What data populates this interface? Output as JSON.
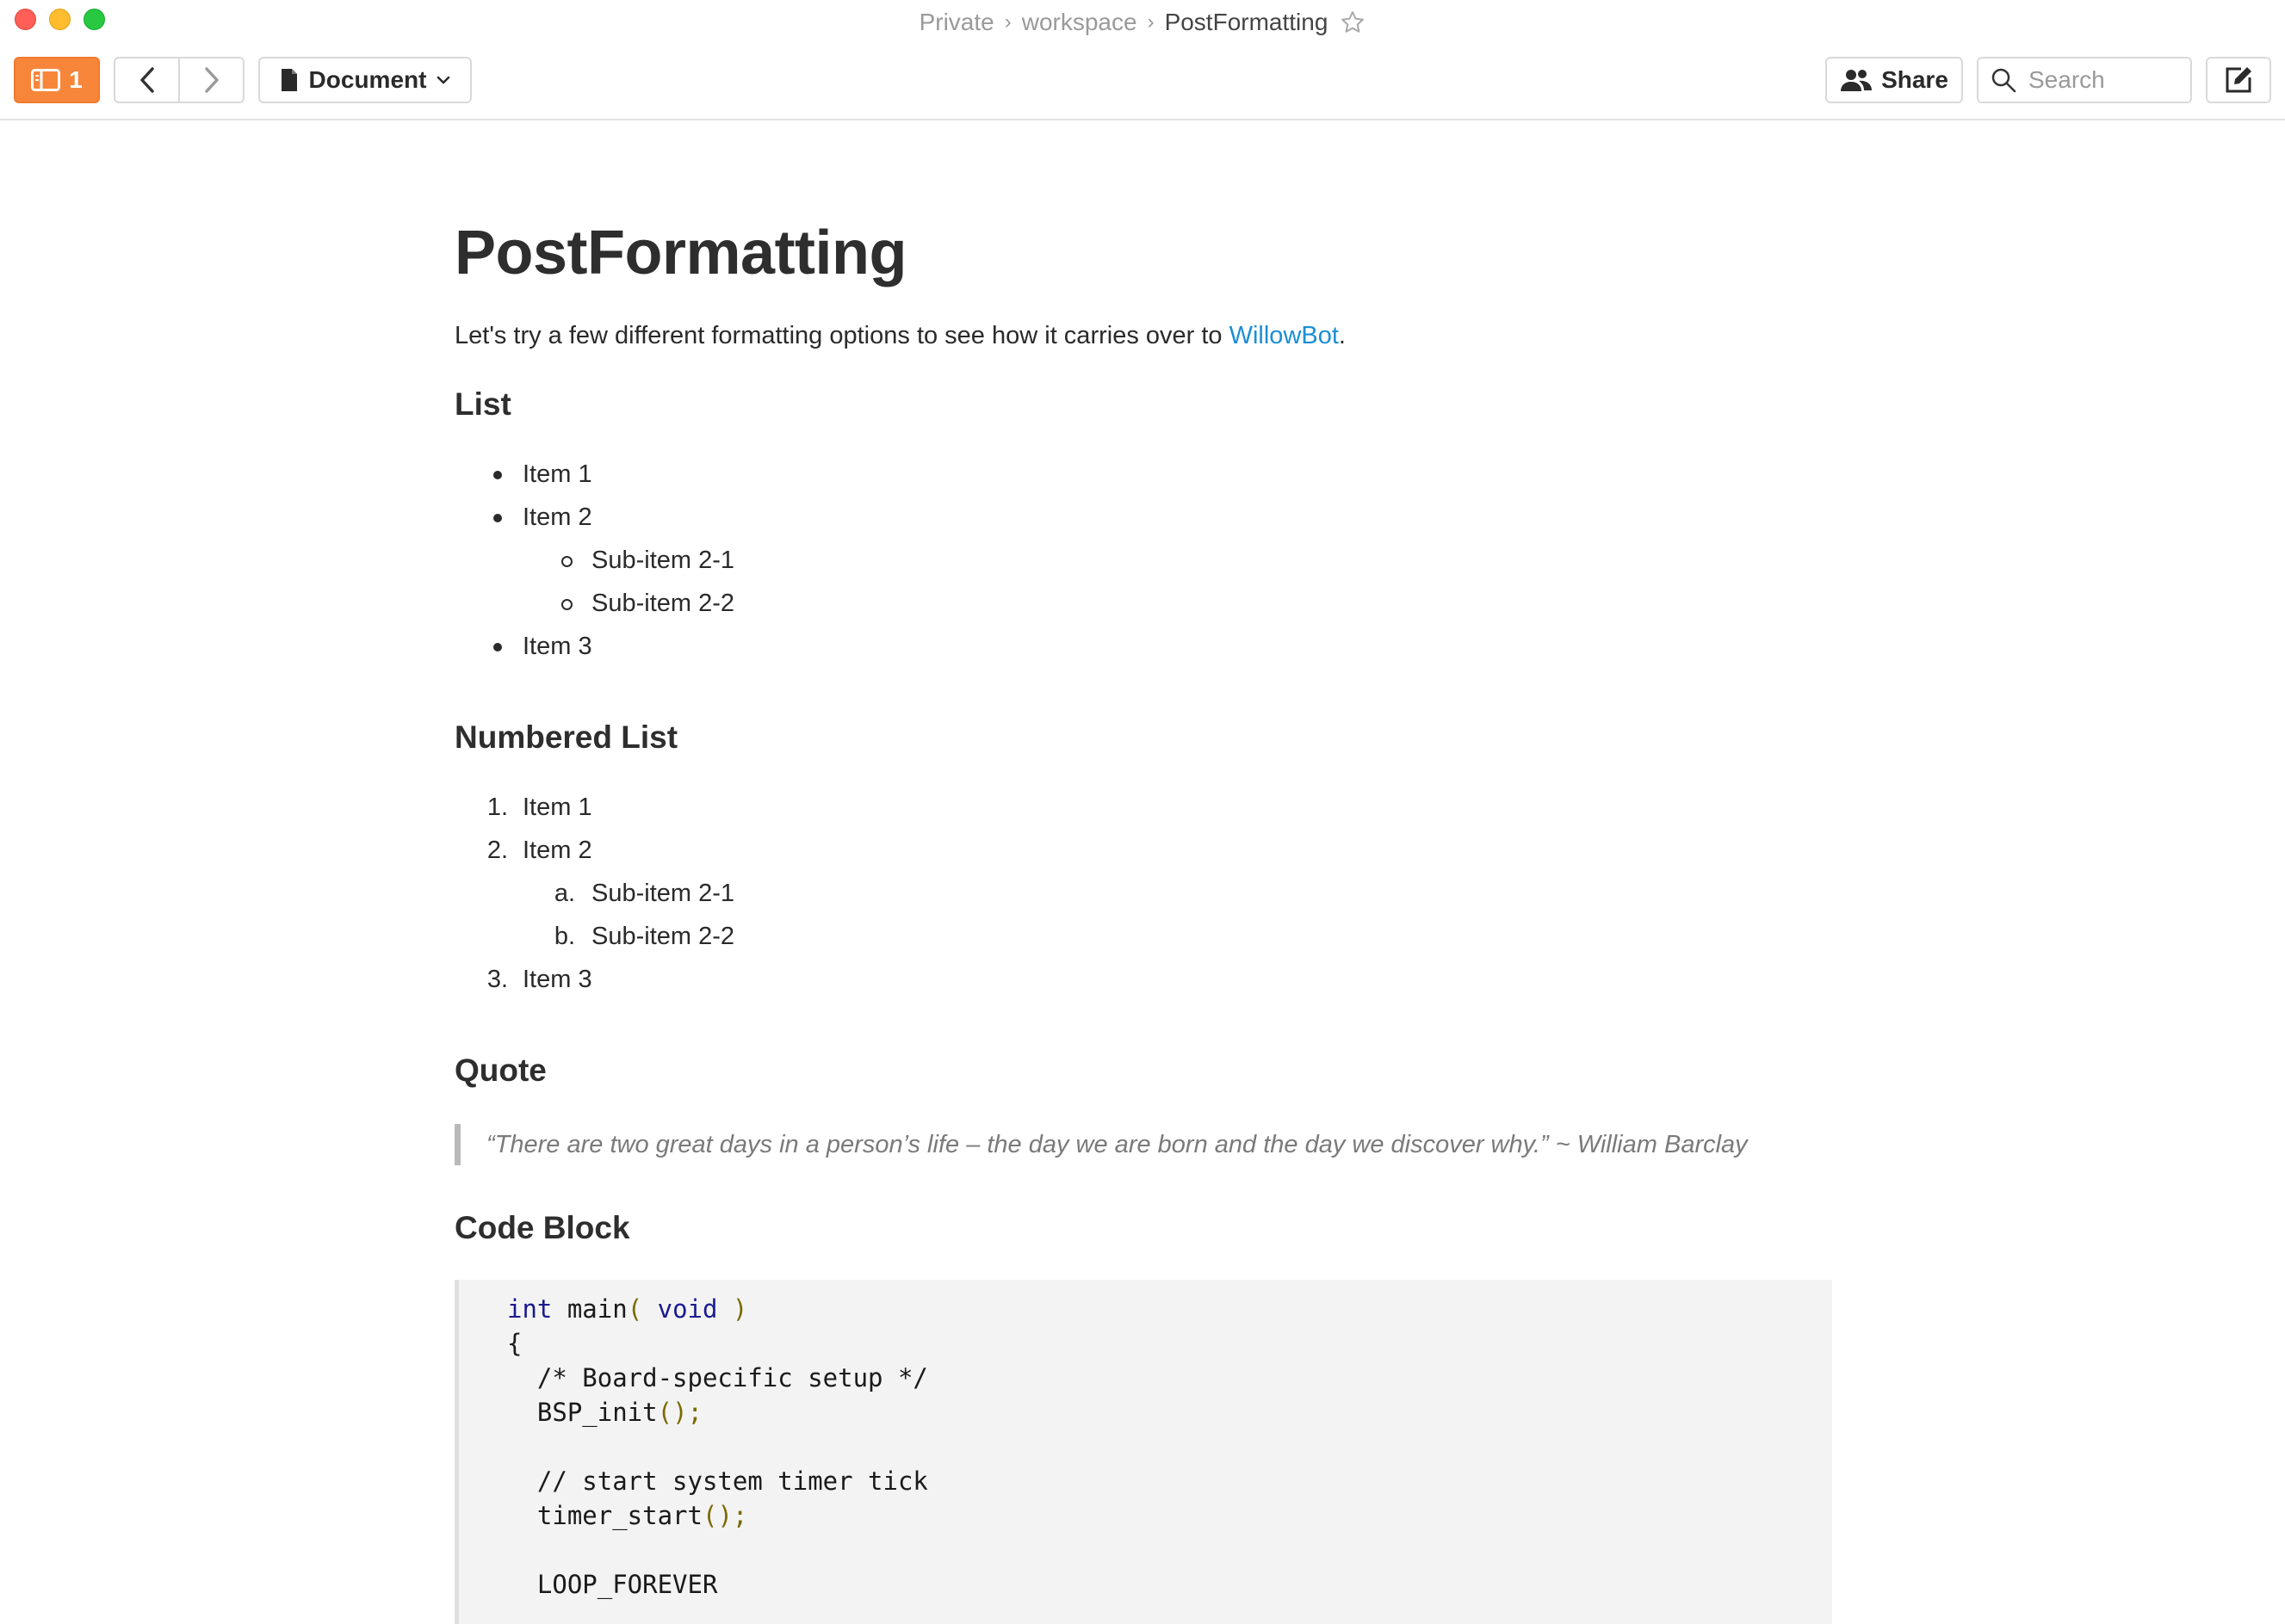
{
  "window": {
    "breadcrumb": [
      "Private",
      "workspace",
      "PostFormatting"
    ]
  },
  "toolbar": {
    "sidebar_count": "1",
    "document_label": "Document",
    "share_label": "Share",
    "search_placeholder": "Search"
  },
  "document": {
    "title": "PostFormatting",
    "intro_text": "Let's try a few different formatting options to see how it carries over to ",
    "intro_link": "WillowBot",
    "intro_end": ".",
    "list_heading": "List",
    "bullet_list": {
      "item1": "Item 1",
      "item2": "Item 2",
      "sub1": "Sub-item 2-1",
      "sub2": "Sub-item 2-2",
      "item3": "Item 3"
    },
    "numbered_heading": "Numbered List",
    "numbered_list": {
      "m1": "1.",
      "item1": "Item 1",
      "m2": "2.",
      "item2": "Item 2",
      "ma": "a.",
      "sub1": "Sub-item 2-1",
      "mb": "b.",
      "sub2": "Sub-item 2-2",
      "m3": "3.",
      "item3": "Item 3"
    },
    "quote_heading": "Quote",
    "quote_text": "“There are two great days in a person’s life – the day we are born and the day we discover why.” ~ William Barclay",
    "code_heading": "Code Block",
    "code": {
      "l1_kw1": "int",
      "l1_fn": " main",
      "l1_p1": "( ",
      "l1_kw2": "void",
      "l1_p2": " )",
      "l2": "{",
      "l3": "  /* Board-specific setup */",
      "l4_fn": "  BSP_init",
      "l4_p": "();",
      "l5": "",
      "l6": "  // start system timer tick",
      "l7_fn": "  timer_start",
      "l7_p": "();",
      "l8": "",
      "l9": "  LOOP_FOREVER"
    }
  }
}
